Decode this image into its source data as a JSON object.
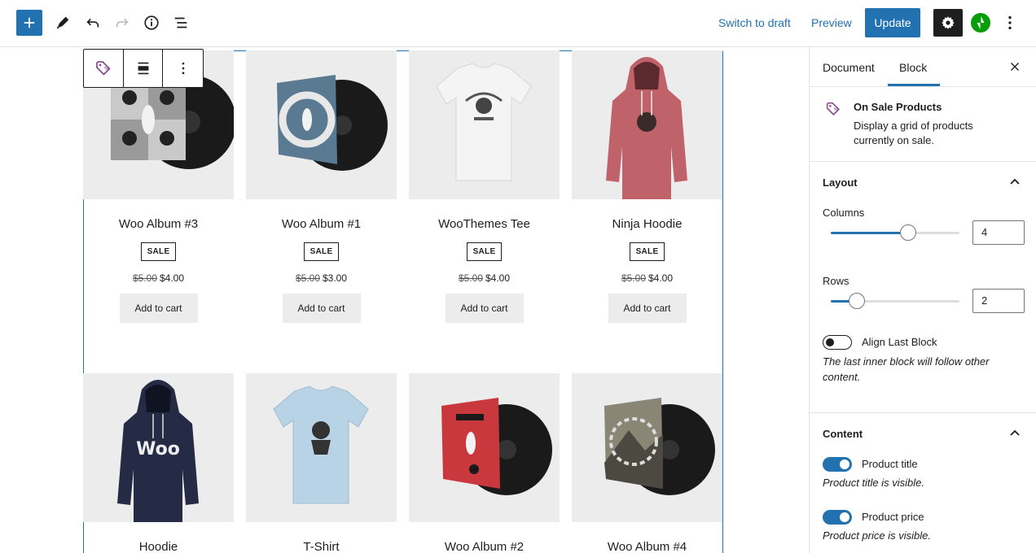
{
  "toolbar": {
    "switch_to_draft": "Switch to draft",
    "preview": "Preview",
    "update": "Update",
    "accent": "#2271b1"
  },
  "products": [
    {
      "title": "Woo Album #3",
      "sale": "SALE",
      "old_price": "$5.00",
      "price": "$4.00",
      "cart": "Add to cart",
      "image": "album-vinyl-ninja"
    },
    {
      "title": "Woo Album #1",
      "sale": "SALE",
      "old_price": "$5.00",
      "price": "$3.00",
      "cart": "Add to cart",
      "image": "album-vinyl-blue"
    },
    {
      "title": "WooThemes Tee",
      "sale": "SALE",
      "old_price": "$5.00",
      "price": "$4.00",
      "cart": "Add to cart",
      "image": "tshirt-white"
    },
    {
      "title": "Ninja Hoodie",
      "sale": "SALE",
      "old_price": "$5.00",
      "price": "$4.00",
      "cart": "Add to cart",
      "image": "hoodie-pink"
    },
    {
      "title": "Hoodie",
      "image": "hoodie-navy"
    },
    {
      "title": "T-Shirt",
      "image": "tshirt-lightblue"
    },
    {
      "title": "Woo Album #2",
      "image": "album-vinyl-red"
    },
    {
      "title": "Woo Album #4",
      "image": "album-vinyl-mountain"
    }
  ],
  "sidebar": {
    "tabs": [
      "Document",
      "Block"
    ],
    "block": {
      "title": "On Sale Products",
      "description": "Display a grid of products currently on sale."
    },
    "layout": {
      "title": "Layout",
      "columns_label": "Columns",
      "columns_value": "4",
      "columns_fill": 0.6,
      "rows_label": "Rows",
      "rows_value": "2",
      "rows_fill": 0.2,
      "align_label": "Align Last Block",
      "align_on": false,
      "align_help": "The last inner block will follow other content."
    },
    "content": {
      "title": "Content",
      "product_title_label": "Product title",
      "product_title_help": "Product title is visible.",
      "product_price_label": "Product price",
      "product_price_help": "Product price is visible."
    }
  }
}
